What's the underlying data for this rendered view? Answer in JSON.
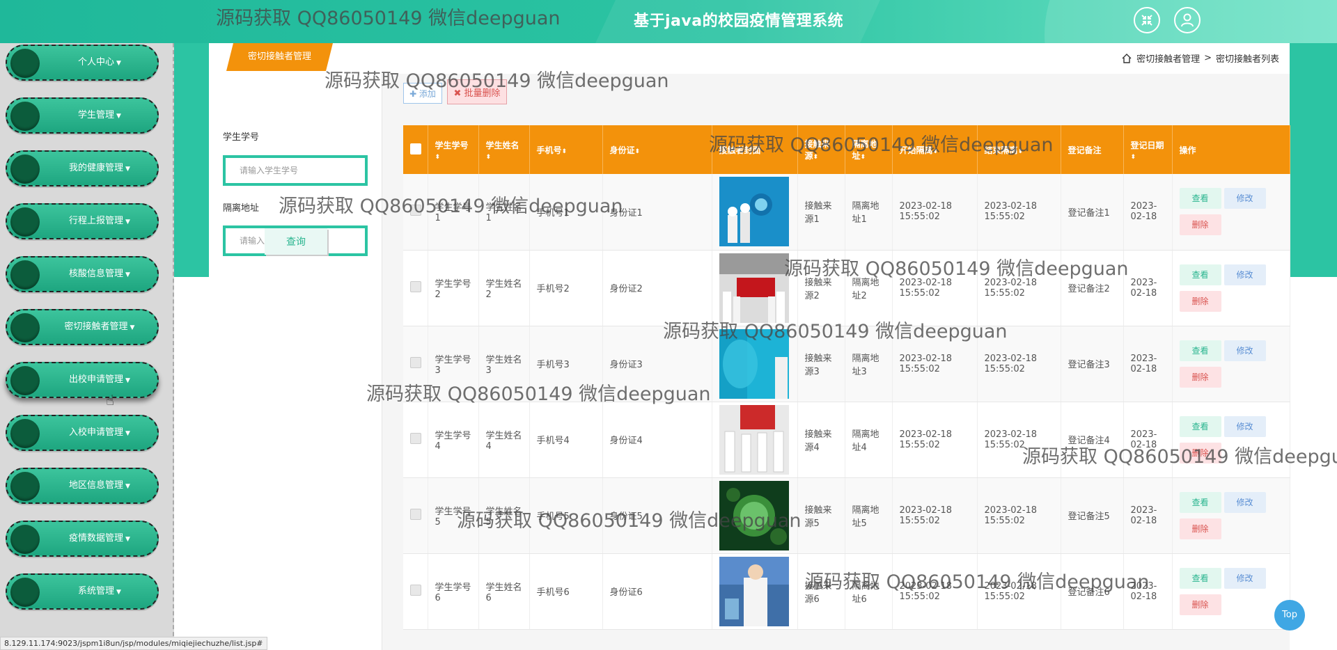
{
  "header": {
    "title": "基于java的校园疫情管理系统",
    "icons": [
      "shrink-icon",
      "user-icon"
    ]
  },
  "sidebar": {
    "items": [
      {
        "label": "个人中心"
      },
      {
        "label": "学生管理"
      },
      {
        "label": "我的健康管理"
      },
      {
        "label": "行程上报管理"
      },
      {
        "label": "核酸信息管理"
      },
      {
        "label": "密切接触者管理"
      },
      {
        "label": "出校申请管理"
      },
      {
        "label": "入校申请管理"
      },
      {
        "label": "地区信息管理"
      },
      {
        "label": "疫情数据管理"
      },
      {
        "label": "系统管理"
      }
    ],
    "caret": "▼"
  },
  "tab": {
    "label": "密切接触者管理"
  },
  "breadcrumb": {
    "part1": "密切接触者管理",
    "sep": ">",
    "part2": "密切接触者列表"
  },
  "search": {
    "field1_label": "学生学号",
    "field1_placeholder": "请输入学生学号",
    "field2_label": "隔离地址",
    "field2_placeholder": "请输入隔离地址",
    "button_label": "查询"
  },
  "toolbar": {
    "add_label": "✚ 添加",
    "batch_delete_label": "✖ 批量删除"
  },
  "table": {
    "headers": [
      "学生学号",
      "学生姓名",
      "手机号",
      "身份证",
      "接触者封面",
      "接触来源",
      "隔离地址",
      "开始隔离",
      "结束隔离",
      "登记备注",
      "登记日期",
      "操作"
    ],
    "sort_glyph": "⬍",
    "rows": [
      {
        "xh": "学生学号1",
        "xm": "学生姓名1",
        "sj": "手机号1",
        "sfz": "身份证1",
        "ly": "接触来源1",
        "dz": "隔离地址1",
        "ks": "2023-02-18 15:55:02",
        "js": "2023-02-18 15:55:02",
        "bz": "登记备注1",
        "rq": "2023-02-18",
        "img": "blue-virus"
      },
      {
        "xh": "学生学号2",
        "xm": "学生姓名2",
        "sj": "手机号2",
        "sfz": "身份证2",
        "ly": "接触来源2",
        "dz": "隔离地址2",
        "ks": "2023-02-18 15:55:02",
        "js": "2023-02-18 15:55:02",
        "bz": "登记备注2",
        "rq": "2023-02-18",
        "img": "red-banner-group"
      },
      {
        "xh": "学生学号3",
        "xm": "学生姓名3",
        "sj": "手机号3",
        "sfz": "身份证3",
        "ly": "接触来源3",
        "dz": "隔离地址3",
        "ks": "2023-02-18 15:55:02",
        "js": "2023-02-18 15:55:02",
        "bz": "登记备注3",
        "rq": "2023-02-18",
        "img": "blue-medical"
      },
      {
        "xh": "学生学号4",
        "xm": "学生姓名4",
        "sj": "手机号4",
        "sfz": "身份证4",
        "ly": "接触来源4",
        "dz": "隔离地址4",
        "ks": "2023-02-18 15:55:02",
        "js": "2023-02-18 15:55:02",
        "bz": "登记备注4",
        "rq": "2023-02-18",
        "img": "medics-room"
      },
      {
        "xh": "学生学号5",
        "xm": "学生姓名5",
        "sj": "手机号5",
        "sfz": "身份证5",
        "ly": "接触来源5",
        "dz": "隔离地址5",
        "ks": "2023-02-18 15:55:02",
        "js": "2023-02-18 15:55:02",
        "bz": "登记备注5",
        "rq": "2023-02-18",
        "img": "green-virus"
      },
      {
        "xh": "学生学号6",
        "xm": "学生姓名6",
        "sj": "手机号6",
        "sfz": "身份证6",
        "ly": "接触来源6",
        "dz": "隔离地址6",
        "ks": "2023-02-18 15:55:02",
        "js": "2023-02-18 15:55:02",
        "bz": "登记备注6",
        "rq": "2023-02-18",
        "img": "lab-doctor"
      }
    ],
    "actions": {
      "view": "查看",
      "edit": "修改",
      "delete": "删除"
    }
  },
  "watermark": "源码获取 QQ86050149 微信deepguan",
  "top_button": "Top",
  "status_url": "8.129.11.174:9023/jspm1i8un/jsp/modules/miqiejiechuzhe/list.jsp#",
  "colors": {
    "teal": "#2cc4a3",
    "orange": "#f3920b",
    "dark_green": "#0c5c3c"
  }
}
